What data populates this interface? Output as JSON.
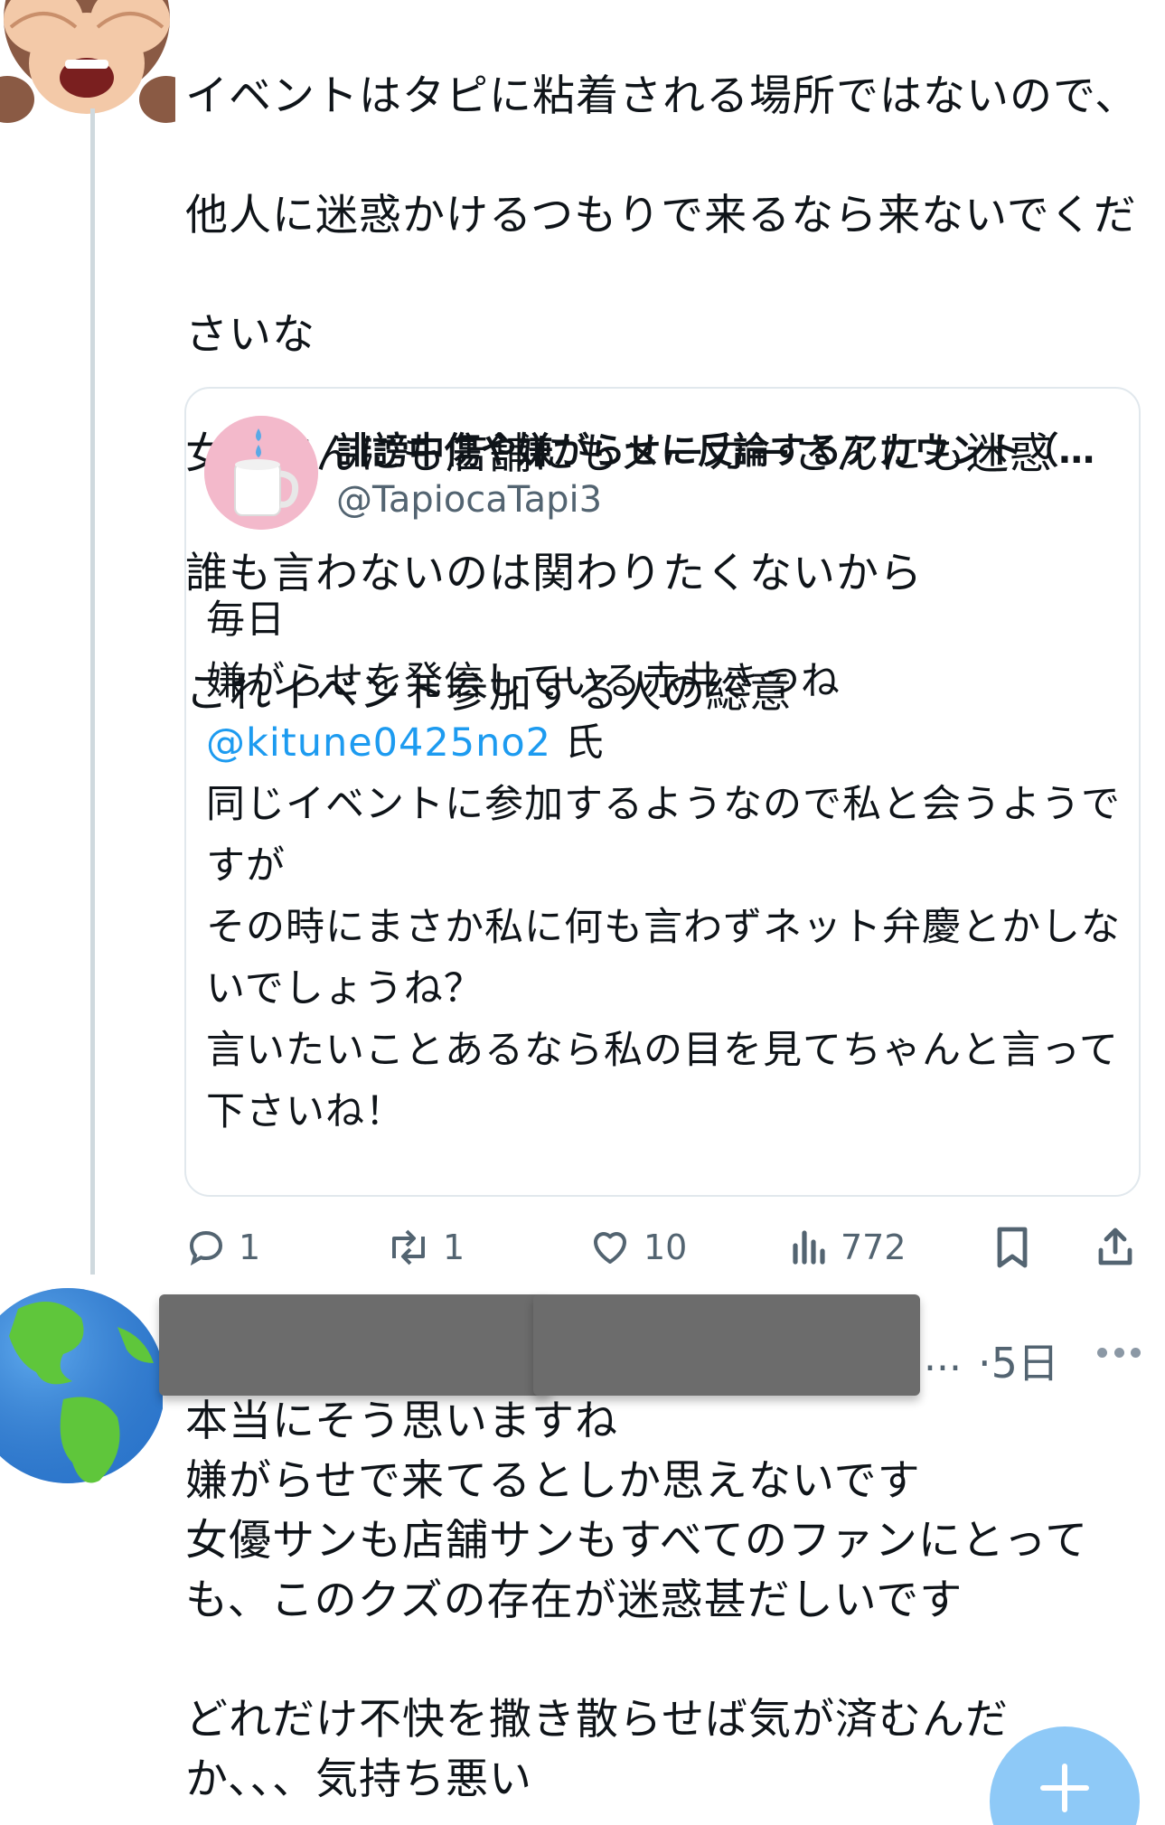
{
  "tweet": {
    "lines": [
      "イベントはタピに粘着される場所ではないので、",
      "他人に迷惑かけるつもりで来るなら来ないでくだ",
      "さいな",
      "女優さんにも店舗にもメーカーさんにも迷惑",
      "誰も言わないのは関わりたくないから",
      "これイベント参加する人の総意"
    ],
    "avatar_icon": "see-no-evil-monkey-emoji"
  },
  "quote": {
    "name": "誹謗中傷や嫌がらせに反論するアカウント（月...",
    "handle": "@TapiocaTapi3",
    "avatar_icon": "cup-with-droplets",
    "lines": [
      "毎日",
      "嫌がらせを発信している赤井きつね"
    ],
    "mention": "@kitune0425no2",
    "mention_suffix": " 氏",
    "lines_after": [
      "同じイベントに参加するようなので私と会うようで",
      "すが",
      "その時にまさか私に何も言わずネット弁慶とかしな",
      "いでしょうね？",
      "言いたいことあるなら私の目を見てちゃんと言って",
      "下さいね！"
    ]
  },
  "actions": {
    "reply_count": "1",
    "retweet_count": "1",
    "like_count": "10",
    "views_count": "772",
    "icons": [
      "reply-icon",
      "retweet-icon",
      "like-icon",
      "views-icon",
      "bookmark-icon",
      "share-icon"
    ]
  },
  "reply": {
    "avatar_icon": "globe-emoji",
    "ellipsis": "...",
    "time": "·5日",
    "lines": [
      "本当にそう思いますね",
      "嫌がらせで来てるとしか思えないです",
      "女優サンも店舗サンもすべてのファンにとって",
      "も、このクズの存在が迷惑甚だしいです",
      "",
      "どれだけ不快を撒き散らせば気が済むんだ",
      "か、、、気持ち悪い"
    ]
  },
  "colors": {
    "accent": "#1d9bf0",
    "secondary_text": "#536471",
    "fab": "#8ec9f7",
    "redaction": "#6c6c6c"
  }
}
